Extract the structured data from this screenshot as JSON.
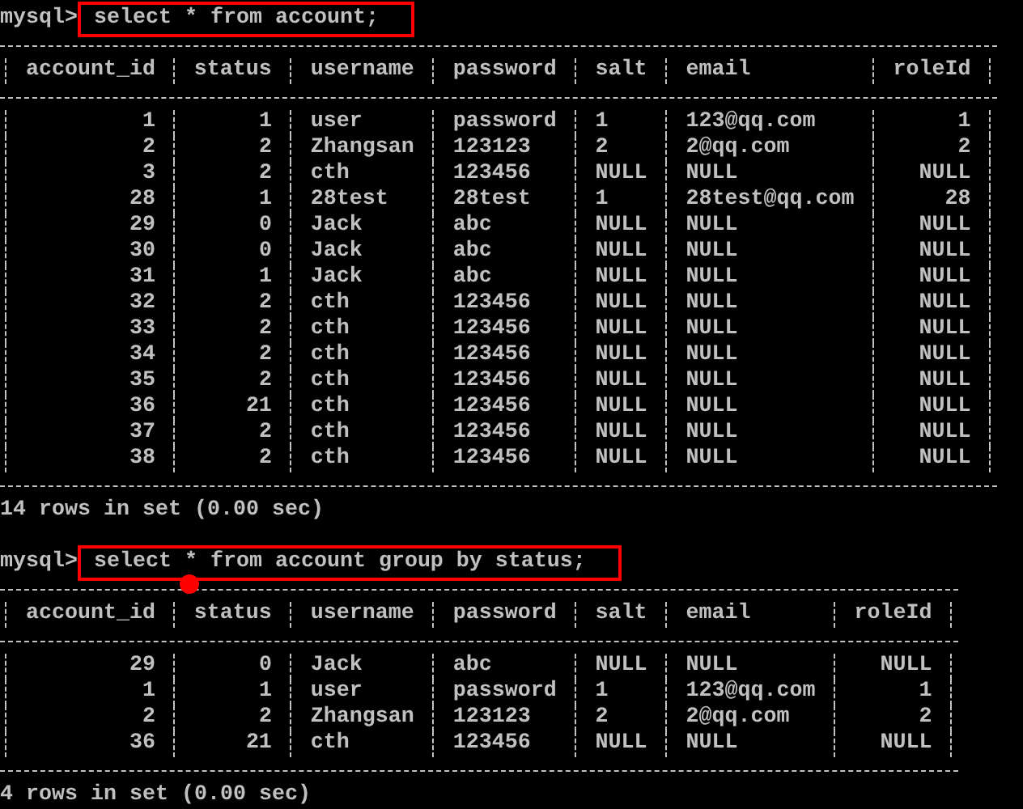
{
  "blocks": [
    {
      "prompt": "mysql>",
      "query": "select * from account;",
      "highlighted": true,
      "columns": [
        {
          "label": "account_id",
          "numeric": true
        },
        {
          "label": "status",
          "numeric": true
        },
        {
          "label": "username",
          "numeric": false
        },
        {
          "label": "password",
          "numeric": false
        },
        {
          "label": "salt",
          "numeric": false
        },
        {
          "label": "email",
          "numeric": false
        },
        {
          "label": "roleId",
          "numeric": true
        }
      ],
      "rows": [
        [
          "1",
          "1",
          "user",
          "password",
          "1",
          "123@qq.com",
          "1"
        ],
        [
          "2",
          "2",
          "Zhangsan",
          "123123",
          "2",
          "2@qq.com",
          "2"
        ],
        [
          "3",
          "2",
          "cth",
          "123456",
          "NULL",
          "NULL",
          "NULL"
        ],
        [
          "28",
          "1",
          "28test",
          "28test",
          "1",
          "28test@qq.com",
          "28"
        ],
        [
          "29",
          "0",
          "Jack",
          "abc",
          "NULL",
          "NULL",
          "NULL"
        ],
        [
          "30",
          "0",
          "Jack",
          "abc",
          "NULL",
          "NULL",
          "NULL"
        ],
        [
          "31",
          "1",
          "Jack",
          "abc",
          "NULL",
          "NULL",
          "NULL"
        ],
        [
          "32",
          "2",
          "cth",
          "123456",
          "NULL",
          "NULL",
          "NULL"
        ],
        [
          "33",
          "2",
          "cth",
          "123456",
          "NULL",
          "NULL",
          "NULL"
        ],
        [
          "34",
          "2",
          "cth",
          "123456",
          "NULL",
          "NULL",
          "NULL"
        ],
        [
          "35",
          "2",
          "cth",
          "123456",
          "NULL",
          "NULL",
          "NULL"
        ],
        [
          "36",
          "21",
          "cth",
          "123456",
          "NULL",
          "NULL",
          "NULL"
        ],
        [
          "37",
          "2",
          "cth",
          "123456",
          "NULL",
          "NULL",
          "NULL"
        ],
        [
          "38",
          "2",
          "cth",
          "123456",
          "NULL",
          "NULL",
          "NULL"
        ]
      ],
      "summary": "14 rows in set (0.00 sec)"
    },
    {
      "prompt": "mysql>",
      "query": "select * from account group by status;",
      "highlighted": true,
      "marker": true,
      "columns": [
        {
          "label": "account_id",
          "numeric": true
        },
        {
          "label": "status",
          "numeric": true
        },
        {
          "label": "username",
          "numeric": false
        },
        {
          "label": "password",
          "numeric": false
        },
        {
          "label": "salt",
          "numeric": false
        },
        {
          "label": "email",
          "numeric": false
        },
        {
          "label": "roleId",
          "numeric": true
        }
      ],
      "rows": [
        [
          "29",
          "0",
          "Jack",
          "abc",
          "NULL",
          "NULL",
          "NULL"
        ],
        [
          "1",
          "1",
          "user",
          "password",
          "1",
          "123@qq.com",
          "1"
        ],
        [
          "2",
          "2",
          "Zhangsan",
          "123123",
          "2",
          "2@qq.com",
          "2"
        ],
        [
          "36",
          "21",
          "cth",
          "123456",
          "NULL",
          "NULL",
          "NULL"
        ]
      ],
      "summary": "4 rows in set (0.00 sec)"
    }
  ]
}
